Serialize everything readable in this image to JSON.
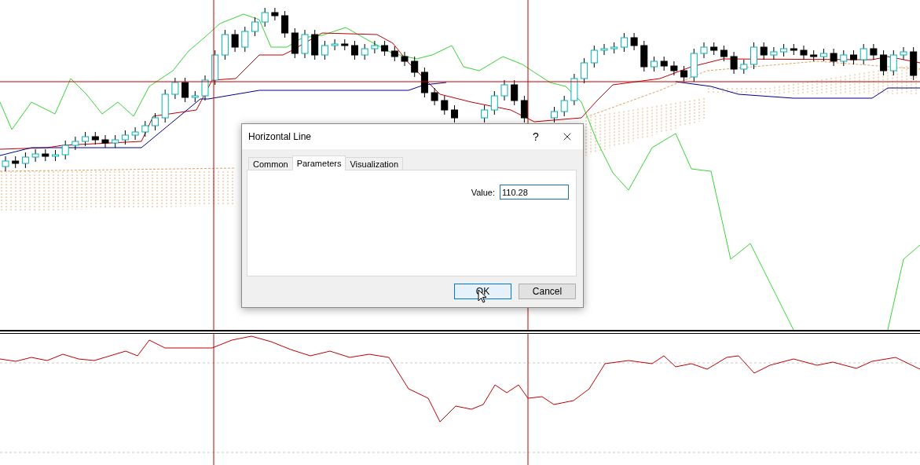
{
  "dialog": {
    "title": "Horizontal Line",
    "help_button": "?",
    "tabs": [
      {
        "label": "Common",
        "selected": false
      },
      {
        "label": "Parameters",
        "selected": true
      },
      {
        "label": "Visualization",
        "selected": false
      }
    ],
    "fields": [
      {
        "label": "Value:",
        "value": "110.28"
      }
    ],
    "buttons": [
      {
        "label": "OK",
        "default": true
      },
      {
        "label": "Cancel",
        "default": false
      }
    ]
  }
}
